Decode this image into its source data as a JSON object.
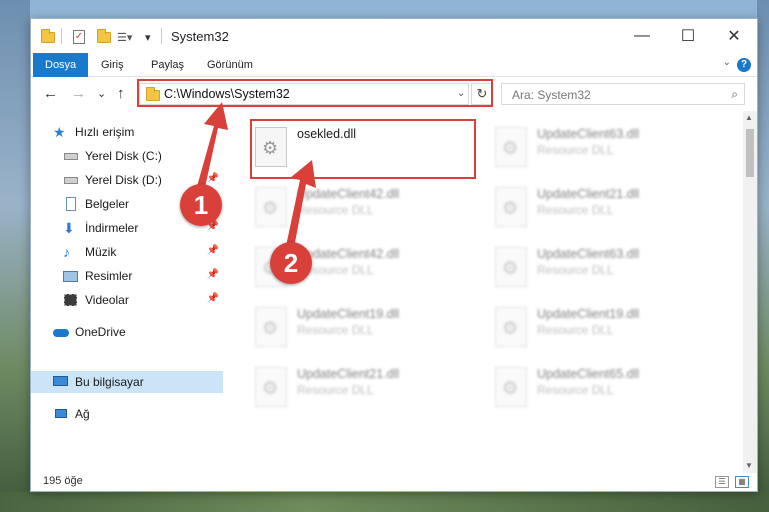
{
  "titlebar": {
    "title": "System32",
    "minimize": "—",
    "maximize": "☐",
    "close": "✕"
  },
  "ribbon": {
    "tabs": [
      "Dosya",
      "Giriş",
      "Paylaş",
      "Görünüm"
    ],
    "help": "?"
  },
  "nav": {
    "address": "C:\\Windows\\System32",
    "search_placeholder": "Ara: System32",
    "back": "←",
    "forward": "→",
    "recent": "⌄",
    "up": "↑",
    "refresh": "↻"
  },
  "sidebar": {
    "items": [
      {
        "label": "Hızlı erişim",
        "icon": "star-icon"
      },
      {
        "label": "Yerel Disk (C:)",
        "icon": "drive-icon",
        "pinned": true
      },
      {
        "label": "Yerel Disk (D:)",
        "icon": "drive-icon",
        "pinned": true
      },
      {
        "label": "Belgeler",
        "icon": "document-icon",
        "pinned": true
      },
      {
        "label": "İndirmeler",
        "icon": "download-icon",
        "pinned": true
      },
      {
        "label": "Müzik",
        "icon": "music-icon",
        "pinned": true
      },
      {
        "label": "Resimler",
        "icon": "picture-icon",
        "pinned": true
      },
      {
        "label": "Videolar",
        "icon": "video-icon",
        "pinned": true
      },
      {
        "label": "OneDrive",
        "icon": "cloud-icon"
      },
      {
        "label": "Bu bilgisayar",
        "icon": "computer-icon",
        "selected": true
      },
      {
        "label": "Ağ",
        "icon": "network-icon"
      }
    ]
  },
  "files": [
    {
      "name": "osekled.dll",
      "type": ""
    },
    {
      "name": "UpdateClient63.dll",
      "type": "Resource DLL"
    },
    {
      "name": "UpdateClient42.dll",
      "type": "Resource DLL"
    },
    {
      "name": "UpdateClient21.dll",
      "type": "Resource DLL"
    },
    {
      "name": "UpdateClient42.dll",
      "type": "Resource DLL"
    },
    {
      "name": "UpdateClient63.dll",
      "type": "Resource DLL"
    },
    {
      "name": "UpdateClient19.dll",
      "type": "Resource DLL"
    },
    {
      "name": "UpdateClient19.dll",
      "type": "Resource DLL"
    },
    {
      "name": "UpdateClient21.dll",
      "type": "Resource DLL"
    },
    {
      "name": "UpdateClient65.dll",
      "type": "Resource DLL"
    }
  ],
  "status": {
    "count": "195 öğe"
  },
  "annotations": {
    "step1": "1",
    "step2": "2"
  },
  "colors": {
    "accent": "#1979ca",
    "highlight": "#d9403a",
    "selection": "#cce4f7"
  }
}
